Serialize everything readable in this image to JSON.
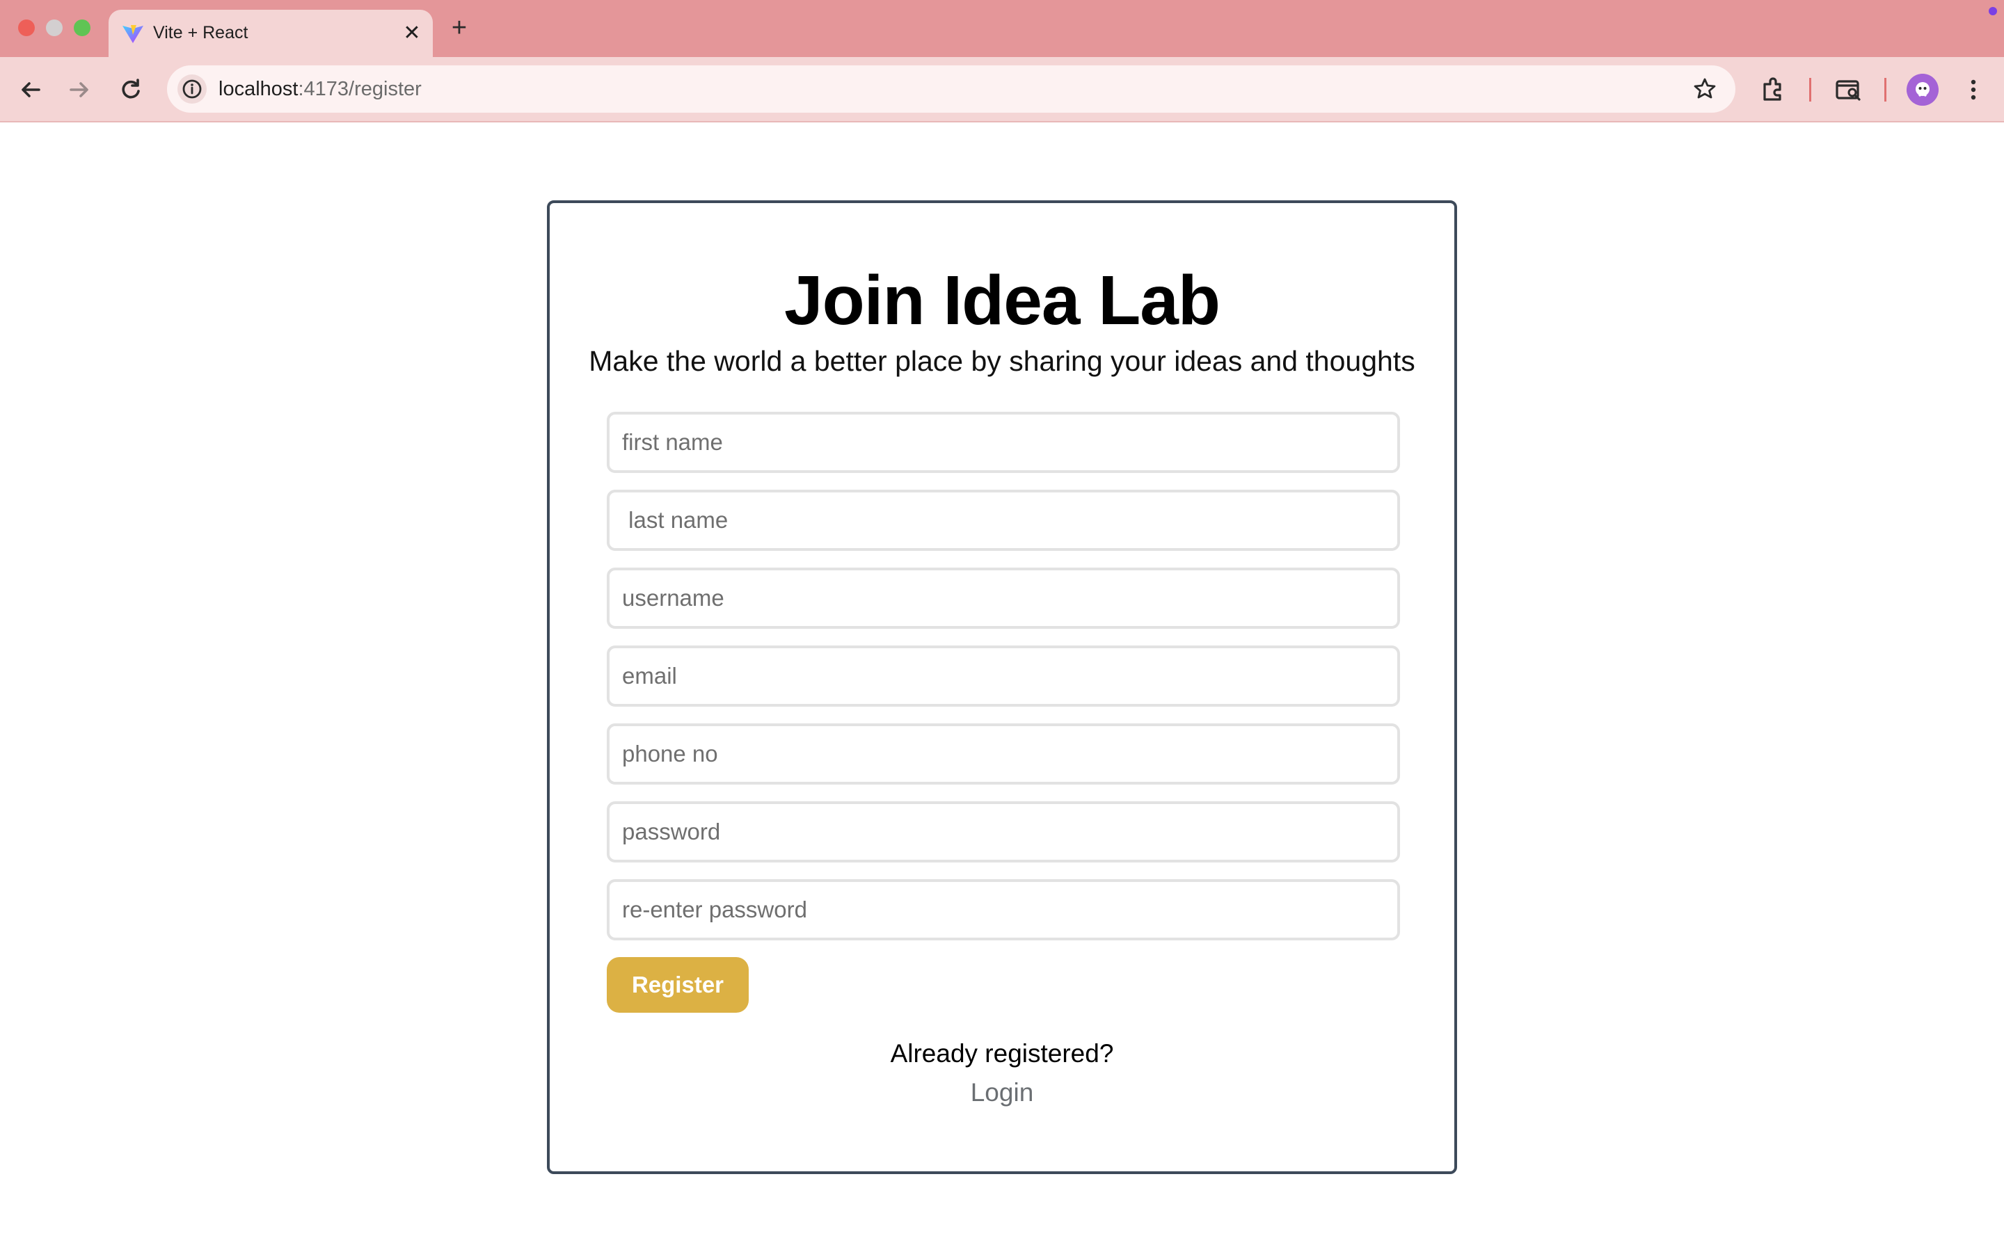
{
  "browser": {
    "tab_title": "Vite + React",
    "tab_close": "✕",
    "new_tab": "+",
    "url_host": "localhost",
    "url_path": ":4173/register",
    "colors": {
      "frame": "#e49699",
      "toolbar": "#f4d5d5",
      "omnibox": "#fdf2f2"
    },
    "icons": [
      "vite-favicon",
      "close-icon",
      "plus-icon",
      "back-arrow-icon",
      "forward-arrow-icon",
      "reload-icon",
      "info-icon",
      "star-icon",
      "extensions-icon",
      "tab-search-icon",
      "avatar",
      "kebab-menu-icon"
    ]
  },
  "page": {
    "title": "Join Idea Lab",
    "subtitle": "Make the world a better place by sharing your ideas and thoughts",
    "fields": {
      "first_name": {
        "placeholder": "first name",
        "value": ""
      },
      "last_name": {
        "placeholder": " last name",
        "value": ""
      },
      "username": {
        "placeholder": "username",
        "value": ""
      },
      "email": {
        "placeholder": "email",
        "value": ""
      },
      "phone": {
        "placeholder": "phone no",
        "value": ""
      },
      "password": {
        "placeholder": "password",
        "value": ""
      },
      "confirm_password": {
        "placeholder": "re-enter password",
        "value": ""
      }
    },
    "register_label": "Register",
    "already_text": "Already registered?",
    "login_label": "Login",
    "colors": {
      "button": "#dcb144",
      "card_border": "#3d4a5a",
      "link": "#6b6f73"
    }
  }
}
